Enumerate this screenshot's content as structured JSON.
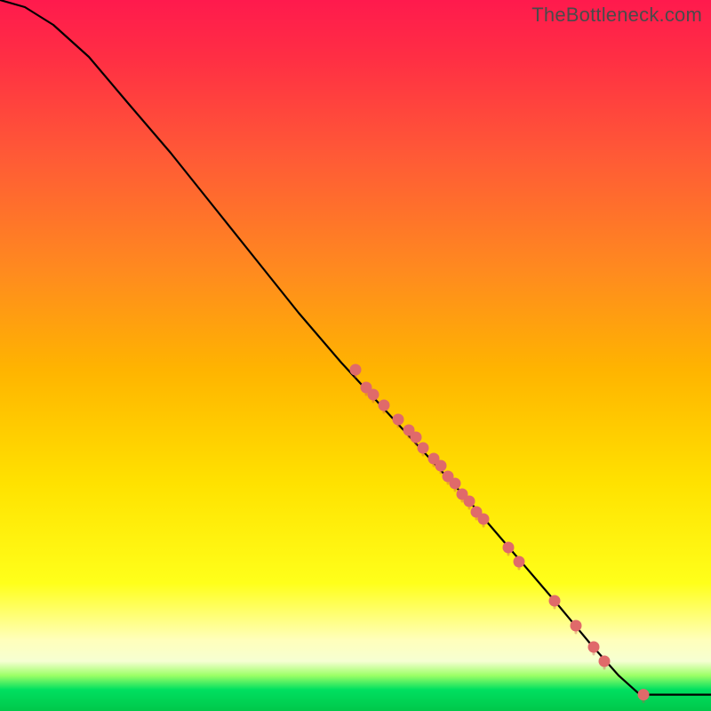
{
  "watermark": "TheBottleneck.com",
  "chart_data": {
    "type": "line",
    "title": "",
    "xlabel": "",
    "ylabel": "",
    "xlim": [
      0,
      100
    ],
    "ylim": [
      0,
      100
    ],
    "curve": [
      {
        "x": 0.0,
        "y": 100.0
      },
      {
        "x": 3.5,
        "y": 99.0
      },
      {
        "x": 7.5,
        "y": 96.5
      },
      {
        "x": 12.5,
        "y": 92.0
      },
      {
        "x": 18.0,
        "y": 85.5
      },
      {
        "x": 24.0,
        "y": 78.5
      },
      {
        "x": 30.0,
        "y": 71.0
      },
      {
        "x": 36.0,
        "y": 63.5
      },
      {
        "x": 42.0,
        "y": 56.0
      },
      {
        "x": 48.0,
        "y": 49.0
      },
      {
        "x": 54.0,
        "y": 42.5
      },
      {
        "x": 60.0,
        "y": 36.0
      },
      {
        "x": 66.0,
        "y": 29.5
      },
      {
        "x": 72.0,
        "y": 22.5
      },
      {
        "x": 78.0,
        "y": 15.5
      },
      {
        "x": 83.0,
        "y": 9.5
      },
      {
        "x": 87.0,
        "y": 5.0
      },
      {
        "x": 90.0,
        "y": 2.3
      },
      {
        "x": 92.0,
        "y": 2.3
      },
      {
        "x": 96.0,
        "y": 2.3
      },
      {
        "x": 100.0,
        "y": 2.3
      }
    ],
    "scatter": [
      {
        "x": 50.0,
        "y": 48.0
      },
      {
        "x": 51.5,
        "y": 45.5
      },
      {
        "x": 52.5,
        "y": 44.5
      },
      {
        "x": 54.0,
        "y": 43.0
      },
      {
        "x": 56.0,
        "y": 41.0
      },
      {
        "x": 57.5,
        "y": 39.5
      },
      {
        "x": 58.5,
        "y": 38.5
      },
      {
        "x": 59.5,
        "y": 37.0
      },
      {
        "x": 61.0,
        "y": 35.5
      },
      {
        "x": 62.0,
        "y": 34.5
      },
      {
        "x": 63.0,
        "y": 33.0
      },
      {
        "x": 64.0,
        "y": 32.0
      },
      {
        "x": 65.0,
        "y": 30.5
      },
      {
        "x": 66.0,
        "y": 29.5
      },
      {
        "x": 67.0,
        "y": 28.0
      },
      {
        "x": 68.0,
        "y": 27.0
      },
      {
        "x": 71.5,
        "y": 23.0
      },
      {
        "x": 73.0,
        "y": 21.0
      },
      {
        "x": 78.0,
        "y": 15.5
      },
      {
        "x": 81.0,
        "y": 12.0
      },
      {
        "x": 83.5,
        "y": 9.0
      },
      {
        "x": 85.0,
        "y": 7.0
      },
      {
        "x": 90.5,
        "y": 2.3
      }
    ],
    "scatter_color": "#e06a6a",
    "scatter_halo_color": "#c94f4f",
    "curve_color": "#000000",
    "curve_width": 2.2
  }
}
